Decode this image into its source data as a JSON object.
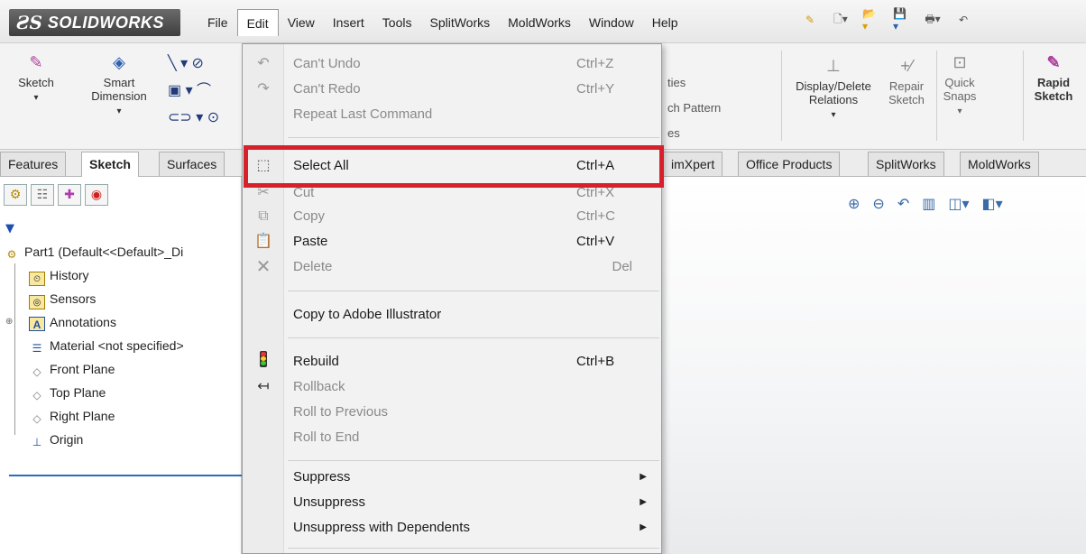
{
  "app": {
    "logo_ds": "ƧS",
    "logo_text": "SOLIDWORKS"
  },
  "menubar": [
    "File",
    "Edit",
    "View",
    "Insert",
    "Tools",
    "SplitWorks",
    "MoldWorks",
    "Window",
    "Help"
  ],
  "ribbon": {
    "sketch": "Sketch",
    "smart_dimension_1": "Smart",
    "smart_dimension_2": "Dimension",
    "ties": "ties",
    "pattern": "ch Pattern",
    "es": "es",
    "display_delete_1": "Display/Delete",
    "display_delete_2": "Relations",
    "repair_1": "Repair",
    "repair_2": "Sketch",
    "quick_1": "Quick",
    "quick_2": "Snaps",
    "rapid_1": "Rapid",
    "rapid_2": "Sketch"
  },
  "tabs": [
    "Features",
    "Sketch",
    "Surfaces",
    "imXpert",
    "Office Products",
    "SplitWorks",
    "MoldWorks"
  ],
  "tree": {
    "root": "Part1  (Default<<Default>_Di",
    "items": [
      "History",
      "Sensors",
      "Annotations",
      "Material <not specified>",
      "Front Plane",
      "Top Plane",
      "Right Plane",
      "Origin"
    ]
  },
  "edit_menu": {
    "undo": {
      "label": "Can't Undo",
      "shortcut": "Ctrl+Z"
    },
    "redo": {
      "label": "Can't Redo",
      "shortcut": "Ctrl+Y"
    },
    "repeat": {
      "label": "Repeat Last Command"
    },
    "select_all": {
      "label": "Select All",
      "shortcut": "Ctrl+A"
    },
    "cut": {
      "label": "Cut",
      "shortcut": "Ctrl+X"
    },
    "copy": {
      "label": "Copy",
      "shortcut": "Ctrl+C"
    },
    "paste": {
      "label": "Paste",
      "shortcut": "Ctrl+V"
    },
    "delete": {
      "label": "Delete",
      "shortcut": "Del"
    },
    "copy_ai": {
      "label": "Copy to Adobe Illustrator"
    },
    "rebuild": {
      "label": "Rebuild",
      "shortcut": "Ctrl+B"
    },
    "rollback": {
      "label": "Rollback"
    },
    "roll_prev": {
      "label": "Roll to Previous"
    },
    "roll_end": {
      "label": "Roll to End"
    },
    "suppress": {
      "label": "Suppress"
    },
    "unsuppress": {
      "label": "Unsuppress"
    },
    "unsuppress_dep": {
      "label": "Unsuppress with Dependents"
    }
  },
  "colors": {
    "highlight": "#d6202a",
    "accent": "#2c6bbd"
  }
}
